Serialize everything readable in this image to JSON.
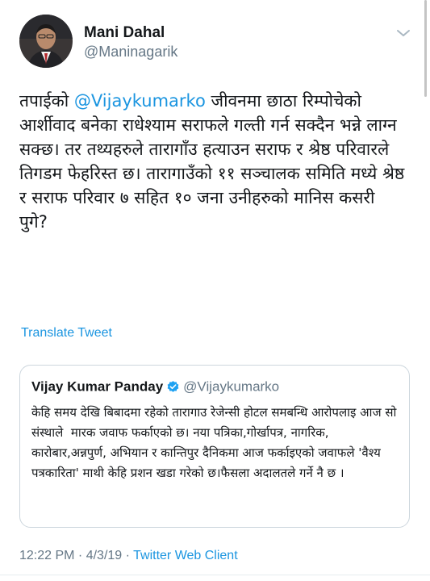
{
  "author": {
    "name": "Mani Dahal",
    "handle": "@Maninagarik"
  },
  "tweet": {
    "text_before_mention": "तपाईको ",
    "mention": "@Vijaykumarko",
    "text_after_mention": " जीवनमा छाठा रिम्पोचेको आर्शीवाद बनेका राधेश्याम सराफले गल्ती गर्न सक्दैन भन्ने लाग्न सक्छ। तर तथ्यहरुले तारागाँउ हत्याउन सराफ र श्रेष्ठ परिवारले तिगडम फेहरिस्त छ। तारागाउँको ११ सञ्चालक समिति मध्ये श्रेष्ठ र सराफ परिवार ७ सहित १० जना उनीहरुको मानिस कसरी पुगे?",
    "translate_label": "Translate Tweet"
  },
  "quote": {
    "name": "Vijay Kumar Panday",
    "handle": "@Vijaykumarko",
    "text": "केहि समय देखि बिबादमा रहेको तारागाउ रेजेन्सी होटल समबन्धि आरोपलाइ आज सो संस्थाले  मारक जवाफ फर्काएको छ। नया पत्रिका,गोर्खापत्र, नागरिक, कारोबार,अन्नपुर्ण, अभियान र कान्तिपुर दैनिकमा आज फर्काइएको जवाफले 'वैश्य पत्रकारिता' माथी केहि प्रशन खडा गरेको छ।फैसला अदालतले गर्ने नै छ ।"
  },
  "footer": {
    "time": "12:22 PM",
    "separator": " · ",
    "date": "4/3/19",
    "source": "Twitter Web Client"
  },
  "colors": {
    "link": "#1b95e0",
    "secondary_text": "#657786",
    "border": "#ccd6dd"
  },
  "icons": [
    "avatar-photo",
    "chevron-down-icon",
    "verified-badge-icon"
  ]
}
